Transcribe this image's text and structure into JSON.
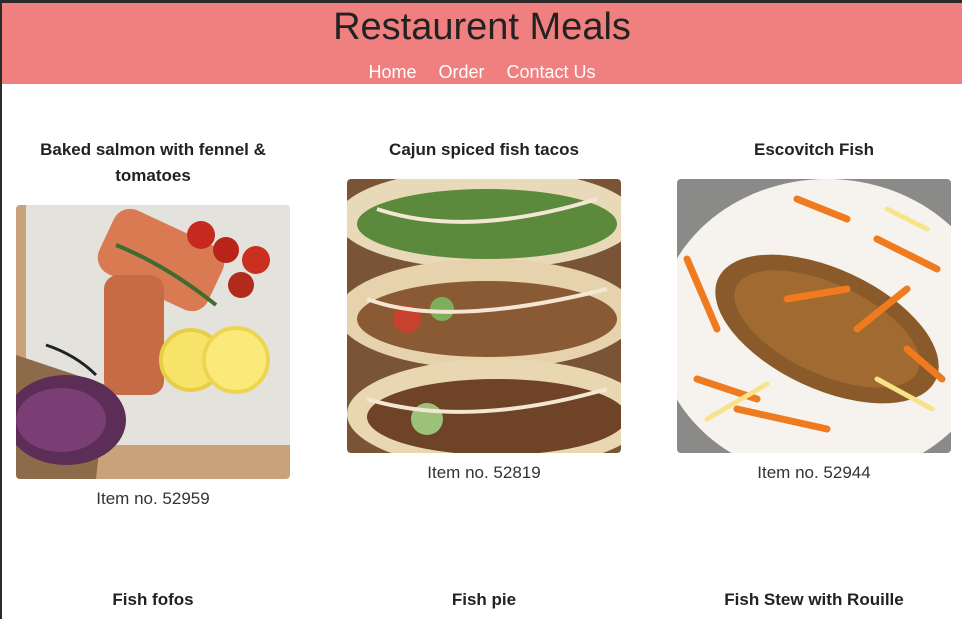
{
  "header": {
    "title": "Restaurent Meals",
    "nav": [
      "Home",
      "Order",
      "Contact Us"
    ]
  },
  "meals": [
    {
      "title": "Baked salmon with fennel & tomatoes",
      "item": "Item no. 52959",
      "image": "baked-salmon-photo"
    },
    {
      "title": "Cajun spiced fish tacos",
      "item": "Item no. 52819",
      "image": "fish-tacos-photo"
    },
    {
      "title": "Escovitch Fish",
      "item": "Item no. 52944",
      "image": "escovitch-fish-photo"
    },
    {
      "title": "Fish fofos"
    },
    {
      "title": "Fish pie"
    },
    {
      "title": "Fish Stew with Rouille"
    }
  ],
  "colors": {
    "header_bg": "#f08080",
    "nav_text": "#ffffff",
    "title_text": "#222222"
  }
}
